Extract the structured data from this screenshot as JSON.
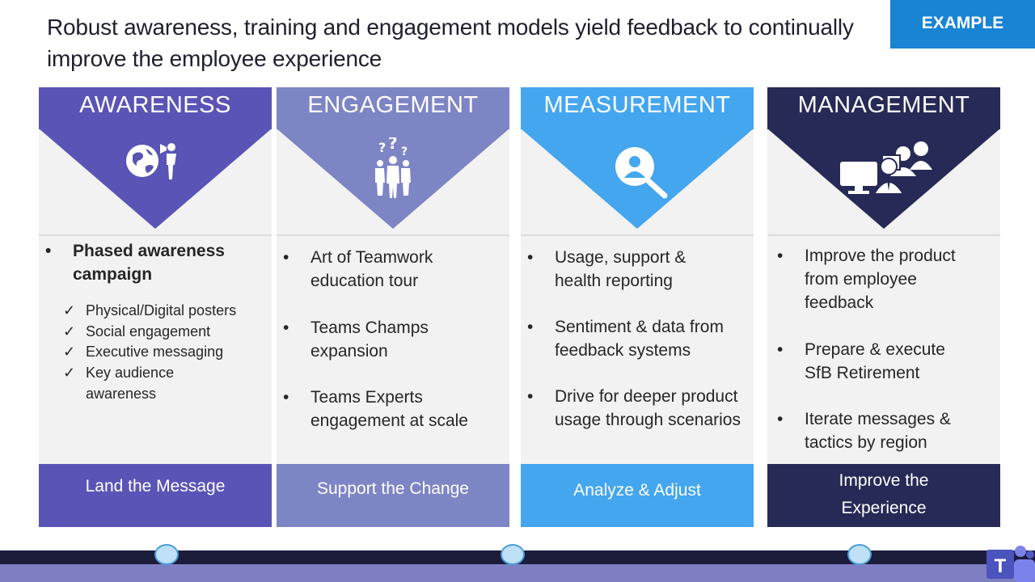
{
  "title": "Robust awareness, training and engagement models yield feedback to continually improve the employee experience",
  "badge": "EXAMPLE",
  "colors": {
    "awareness": "#5a54b6",
    "engagement": "#7e85c4",
    "measurement": "#44a6ef",
    "management": "#272a56",
    "badge": "#1784d4"
  },
  "columns": [
    {
      "header": "AWARENESS",
      "icon": "globe-megaphone-icon",
      "bullet": "Phased awareness campaign",
      "checks": [
        "Physical/Digital posters",
        "Social engagement",
        "Executive messaging",
        "Key audience awareness"
      ],
      "footer": "Land the Message"
    },
    {
      "header": "ENGAGEMENT",
      "icon": "people-questions-icon",
      "bullets": [
        "Art of Teamwork education tour",
        "Teams Champs expansion",
        "Teams Experts engagement at scale"
      ],
      "footer": "Support the Change"
    },
    {
      "header": "MEASUREMENT",
      "icon": "search-person-icon",
      "bullets": [
        "Usage, support & health reporting",
        "Sentiment & data from feedback systems",
        "Drive for deeper product usage through scenarios"
      ],
      "footer": "Analyze & Adjust"
    },
    {
      "header": "MANAGEMENT",
      "icon": "computer-users-icon",
      "bullets": [
        "Improve the product from employee feedback",
        "Prepare & execute SfB Retirement",
        "Iterate messages & tactics by region"
      ],
      "footer": "Improve the Experience"
    }
  ],
  "logo": {
    "icon": "teams-logo-icon",
    "letter": "T"
  }
}
